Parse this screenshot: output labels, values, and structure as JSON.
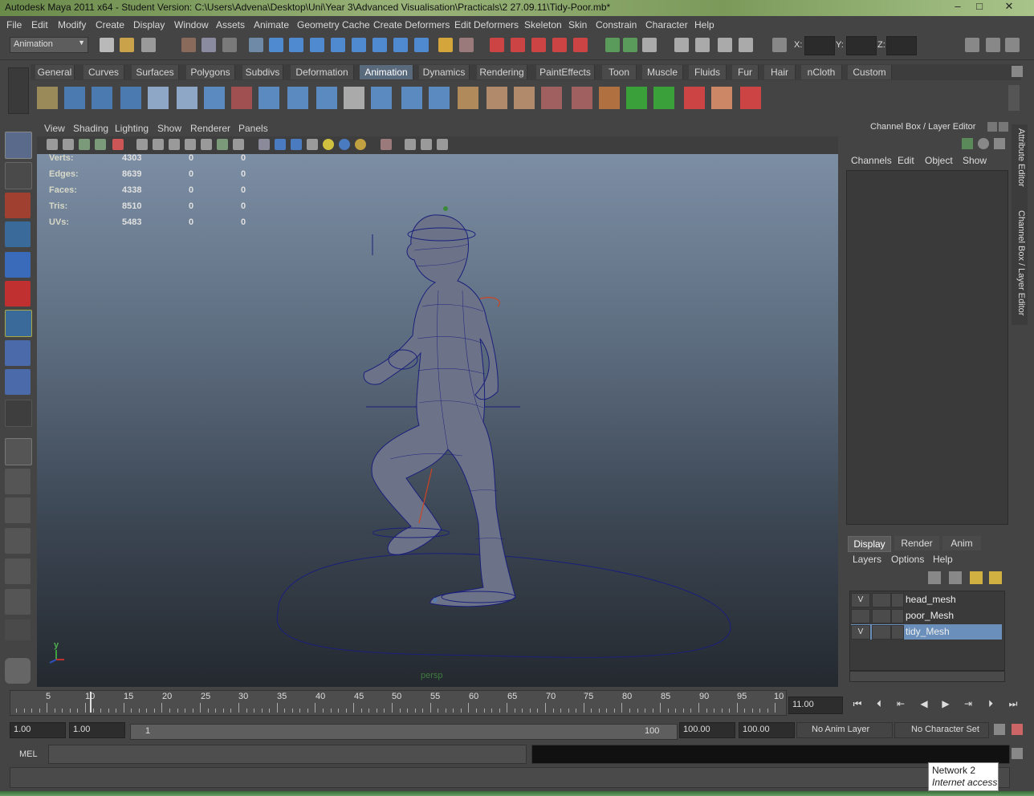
{
  "window": {
    "title": "Autodesk Maya 2011 x64 - Student Version: C:\\Users\\Advena\\Desktop\\Uni\\Year 3\\Advanced Visualisation\\Practicals\\2 27.09.11\\Tidy-Poor.mb*",
    "minimize": "–",
    "maximize": "□",
    "close": "✕"
  },
  "menubar": [
    "File",
    "Edit",
    "Modify",
    "Create",
    "Display",
    "Window",
    "Assets",
    "Animate",
    "Geometry Cache",
    "Create Deformers",
    "Edit Deformers",
    "Skeleton",
    "Skin",
    "Constrain",
    "Character",
    "Help"
  ],
  "statusline": {
    "mode": "Animation",
    "x_label": "X:",
    "y_label": "Y:",
    "z_label": "Z:"
  },
  "shelf": {
    "tabs": [
      "General",
      "Curves",
      "Surfaces",
      "Polygons",
      "Subdivs",
      "Deformation",
      "Animation",
      "Dynamics",
      "Rendering",
      "PaintEffects",
      "Toon",
      "Muscle",
      "Fluids",
      "Fur",
      "Hair",
      "nCloth",
      "Custom"
    ],
    "active_tab": "Animation"
  },
  "panel": {
    "menus": [
      "View",
      "Shading",
      "Lighting",
      "Show",
      "Renderer",
      "Panels"
    ],
    "camera": "persp"
  },
  "hud": {
    "rows": [
      {
        "label": "Verts:",
        "v1": "4303",
        "v2": "0",
        "v3": "0"
      },
      {
        "label": "Edges:",
        "v1": "8639",
        "v2": "0",
        "v3": "0"
      },
      {
        "label": "Faces:",
        "v1": "4338",
        "v2": "0",
        "v3": "0"
      },
      {
        "label": "Tris:",
        "v1": "8510",
        "v2": "0",
        "v3": "0"
      },
      {
        "label": "UVs:",
        "v1": "5483",
        "v2": "0",
        "v3": "0"
      }
    ],
    "axis_y": "y"
  },
  "channel_box": {
    "title": "Channel Box / Layer Editor",
    "menus": [
      "Channels",
      "Edit",
      "Object",
      "Show"
    ]
  },
  "layer_editor": {
    "tabs": [
      "Display",
      "Render",
      "Anim"
    ],
    "active_tab": "Display",
    "menus": [
      "Layers",
      "Options",
      "Help"
    ],
    "layers": [
      {
        "vis": "V",
        "name": "head_mesh",
        "selected": false
      },
      {
        "vis": "",
        "name": "poor_Mesh",
        "selected": false
      },
      {
        "vis": "V",
        "name": "tidy_Mesh",
        "selected": true
      }
    ]
  },
  "side_tabs": [
    "Attribute Editor",
    "Channel Box / Layer Editor"
  ],
  "time_slider": {
    "ticks": [
      "5",
      "10",
      "15",
      "20",
      "25",
      "30",
      "35",
      "40",
      "45",
      "50",
      "55",
      "60",
      "65",
      "70",
      "75",
      "80",
      "85",
      "90",
      "95",
      "10"
    ],
    "current_time": "11.00"
  },
  "range_slider": {
    "start_time": "1.00",
    "range_start": "1.00",
    "bar_start": "1",
    "bar_end": "100",
    "range_end": "100.00",
    "end_time": "100.00",
    "anim_layer": "No Anim Layer",
    "character_set": "No Character Set"
  },
  "command_line": {
    "label": "MEL"
  },
  "tooltip": {
    "line1": "Network  2",
    "line2": "Internet access"
  },
  "colors": {
    "accent": "#5a6a7d",
    "selection": "#6a8fba",
    "wireframe": "#1a1f7a"
  }
}
